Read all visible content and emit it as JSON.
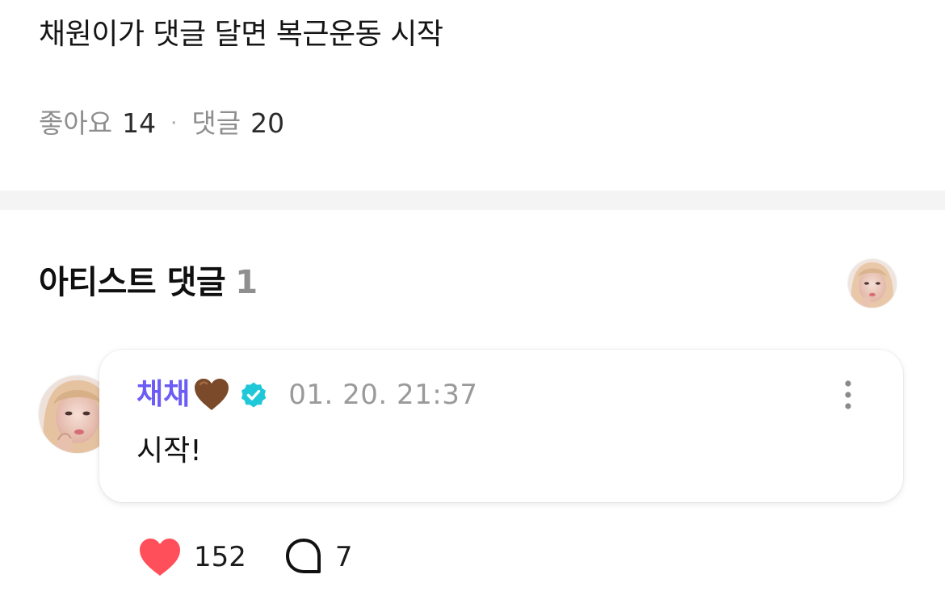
{
  "post": {
    "text": "채원이가 댓글 달면 복근운동 시작"
  },
  "stats": {
    "likes_label": "좋아요",
    "likes_count": "14",
    "separator": "·",
    "comments_label": "댓글",
    "comments_count": "20"
  },
  "artist_section": {
    "title": "아티스트 댓글",
    "count": "1"
  },
  "comment": {
    "author": "채채",
    "author_color": "#6b5cf6",
    "author_emoji": "brown-heart-icon",
    "verified_icon": "verified-badge-icon",
    "verified_color": "#1ec8d8",
    "timestamp": "01. 20. 21:37",
    "text": "시작!",
    "like_count": "152",
    "reply_count": "7",
    "like_color": "#ff4f5a"
  },
  "icons": {
    "more": "more-vertical-icon",
    "like": "heart-icon",
    "reply": "speech-bubble-icon"
  }
}
